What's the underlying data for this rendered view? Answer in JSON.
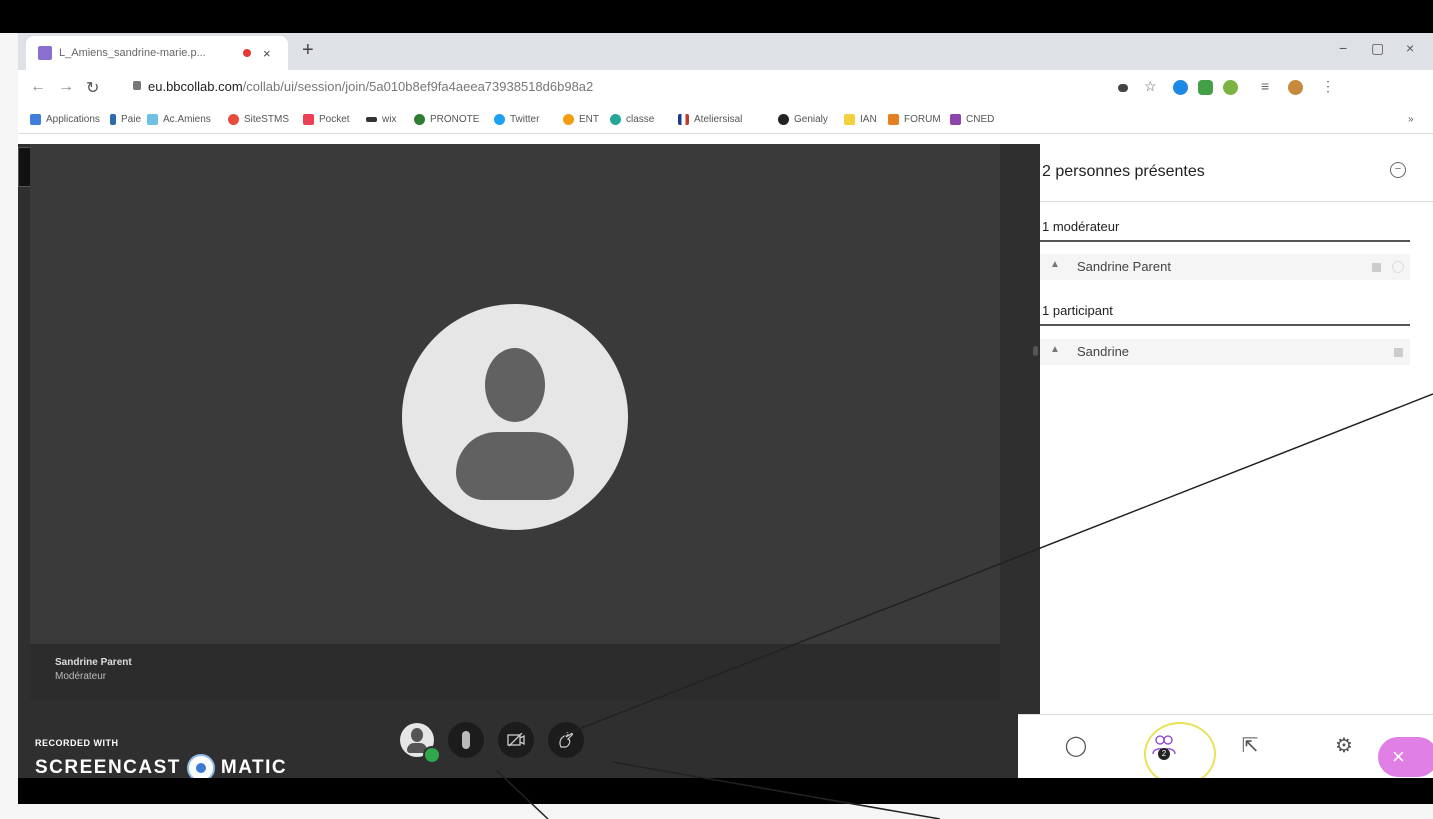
{
  "browser": {
    "tab_title": "L_Amiens_sandrine-marie.p...",
    "tab_close": "×",
    "new_tab": "+",
    "win_min": "−",
    "win_max": "▢",
    "win_close": "×",
    "url_host": "eu.bbcollab.com",
    "url_path": "/collab/ui/session/join/5a010b8ef9fa4aeea73938518d6b98a2",
    "bookmarks": [
      "Applications",
      "Paie",
      "Ac.Amiens",
      "SiteSTMS",
      "Pocket",
      "wix",
      "PRONOTE",
      "Twitter",
      "ENT",
      "classe",
      "Ateliersisal",
      "Genialy",
      "IAN",
      "FORUM",
      "CNED"
    ],
    "bookmarks_more": "»"
  },
  "stage": {
    "presenter_name": "Sandrine Parent",
    "presenter_role": "Modérateur"
  },
  "watermark": {
    "line1": "RECORDED WITH",
    "left": "SCREENCAST",
    "right": "MATIC"
  },
  "panel": {
    "title": "2 personnes présentes",
    "collapse": "−",
    "moderators_header": "1 modérateur",
    "moderator_name": "Sandrine Parent",
    "participants_header": "1 participant",
    "participant_name": "Sandrine",
    "person_glyph": "▲"
  },
  "tabbar": {
    "chat": "◯",
    "attendees_count": "2",
    "share": "⇱",
    "settings": "⚙",
    "leave": "×"
  },
  "colors": {
    "stage_bg": "#3a3a3a",
    "leave_button": "#e080e6",
    "cursor_highlight": "#e8e25a",
    "camera_ok": "#2ea84a"
  }
}
